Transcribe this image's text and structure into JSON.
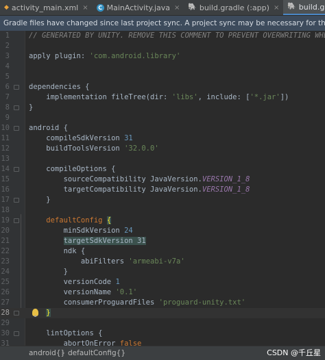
{
  "tabs": [
    {
      "label": "activity_main.xml",
      "icon": "xml-file-icon"
    },
    {
      "label": "MainActivity.java",
      "icon": "java-class-icon"
    },
    {
      "label": "build.gradle (:app)",
      "icon": "gradle-file-icon"
    },
    {
      "label": "build.gradle (:unityLibrary)",
      "icon": "gradle-file-icon",
      "active": true
    }
  ],
  "notification": "Gradle files have changed since last project sync. A project sync may be necessary for the IDE to work properly.",
  "code_lines": [
    [
      {
        "t": "// GENERATED BY UNITY. REMOVE THIS COMMENT TO PREVENT OVERWRITING WHEN EXPO",
        "c": "t-cmt"
      }
    ],
    [],
    [
      {
        "t": "apply plugin: "
      },
      {
        "t": "'com.android.library'",
        "c": "t-str"
      }
    ],
    [],
    [],
    [
      {
        "t": "dependencies {"
      }
    ],
    [
      {
        "t": "    implementation fileTree("
      },
      {
        "t": "dir: ",
        "c": "t-fn"
      },
      {
        "t": "'libs'",
        "c": "t-str"
      },
      {
        "t": ", "
      },
      {
        "t": "include: ",
        "c": "t-fn"
      },
      {
        "t": "["
      },
      {
        "t": "'*.jar'",
        "c": "t-str"
      },
      {
        "t": "])"
      }
    ],
    [
      {
        "t": "}"
      }
    ],
    [],
    [
      {
        "t": "android {"
      }
    ],
    [
      {
        "t": "    compileSdkVersion "
      },
      {
        "t": "31",
        "c": "t-num"
      }
    ],
    [
      {
        "t": "    buildToolsVersion "
      },
      {
        "t": "'32.0.0'",
        "c": "t-str"
      }
    ],
    [],
    [
      {
        "t": "    compileOptions {"
      }
    ],
    [
      {
        "t": "        sourceCompatibility JavaVersion."
      },
      {
        "t": "VERSION_1_8",
        "c": "t-const"
      }
    ],
    [
      {
        "t": "        targetCompatibility JavaVersion."
      },
      {
        "t": "VERSION_1_8",
        "c": "t-const"
      }
    ],
    [
      {
        "t": "    }"
      }
    ],
    [],
    [
      {
        "t": "    "
      },
      {
        "t": "defaultConfig",
        "c": "t-kw"
      },
      {
        "t": " "
      },
      {
        "t": "{",
        "c": "t-brace-hl"
      }
    ],
    [
      {
        "t": "        minSdkVersion "
      },
      {
        "t": "24",
        "c": "t-num"
      }
    ],
    [
      {
        "t": "        "
      },
      {
        "t": "targetSdkVersion 31",
        "c": "t-hl"
      }
    ],
    [
      {
        "t": "        ndk {"
      }
    ],
    [
      {
        "t": "            abiFilters "
      },
      {
        "t": "'armeabi-v7a'",
        "c": "t-str"
      }
    ],
    [
      {
        "t": "        }"
      }
    ],
    [
      {
        "t": "        versionCode "
      },
      {
        "t": "1",
        "c": "t-num"
      }
    ],
    [
      {
        "t": "        versionName "
      },
      {
        "t": "'0.1'",
        "c": "t-str"
      }
    ],
    [
      {
        "t": "        consumerProguardFiles "
      },
      {
        "t": "'proguard-unity.txt'",
        "c": "t-str"
      }
    ],
    [
      {
        "t": "    "
      },
      {
        "t": "}",
        "c": "t-brace-hl"
      }
    ],
    [],
    [
      {
        "t": "    lintOptions {"
      }
    ],
    [
      {
        "t": "        abortOnError "
      },
      {
        "t": "false",
        "c": "t-kw"
      }
    ]
  ],
  "line_numbers": [
    "1",
    "2",
    "3",
    "4",
    "5",
    "6",
    "7",
    "8",
    "9",
    "10",
    "11",
    "12",
    "13",
    "14",
    "15",
    "16",
    "17",
    "18",
    "19",
    "20",
    "21",
    "22",
    "23",
    "24",
    "25",
    "26",
    "27",
    "28",
    "29",
    "30",
    "31"
  ],
  "current_line": "28",
  "breadcrumbs": [
    "android{}",
    "defaultConfig{}"
  ],
  "breadcrumb_separator": "›",
  "watermark": "CSDN @千丘星"
}
